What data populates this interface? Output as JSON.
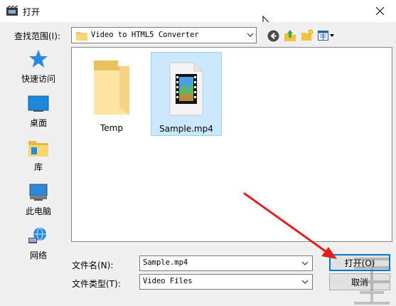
{
  "window": {
    "title": "打开"
  },
  "lookin": {
    "label": "查找范围(I):",
    "value": "Video to HTML5 Converter"
  },
  "places": [
    {
      "label": "快速访问",
      "icon": "star-icon"
    },
    {
      "label": "桌面",
      "icon": "desktop-icon"
    },
    {
      "label": "库",
      "icon": "library-icon"
    },
    {
      "label": "此电脑",
      "icon": "computer-icon"
    },
    {
      "label": "网络",
      "icon": "network-icon"
    }
  ],
  "files": [
    {
      "name": "Temp",
      "type": "folder",
      "selected": false
    },
    {
      "name": "Sample.mp4",
      "type": "video",
      "selected": true
    }
  ],
  "filename": {
    "label": "文件名(N):",
    "value": "Sample.mp4"
  },
  "filetype": {
    "label": "文件类型(T):",
    "value": "Video Files"
  },
  "buttons": {
    "open": "打开(O)",
    "cancel": "取消"
  },
  "colors": {
    "accent": "#0078d7",
    "selection": "#cce8ff",
    "annotation": "#e0201f"
  }
}
